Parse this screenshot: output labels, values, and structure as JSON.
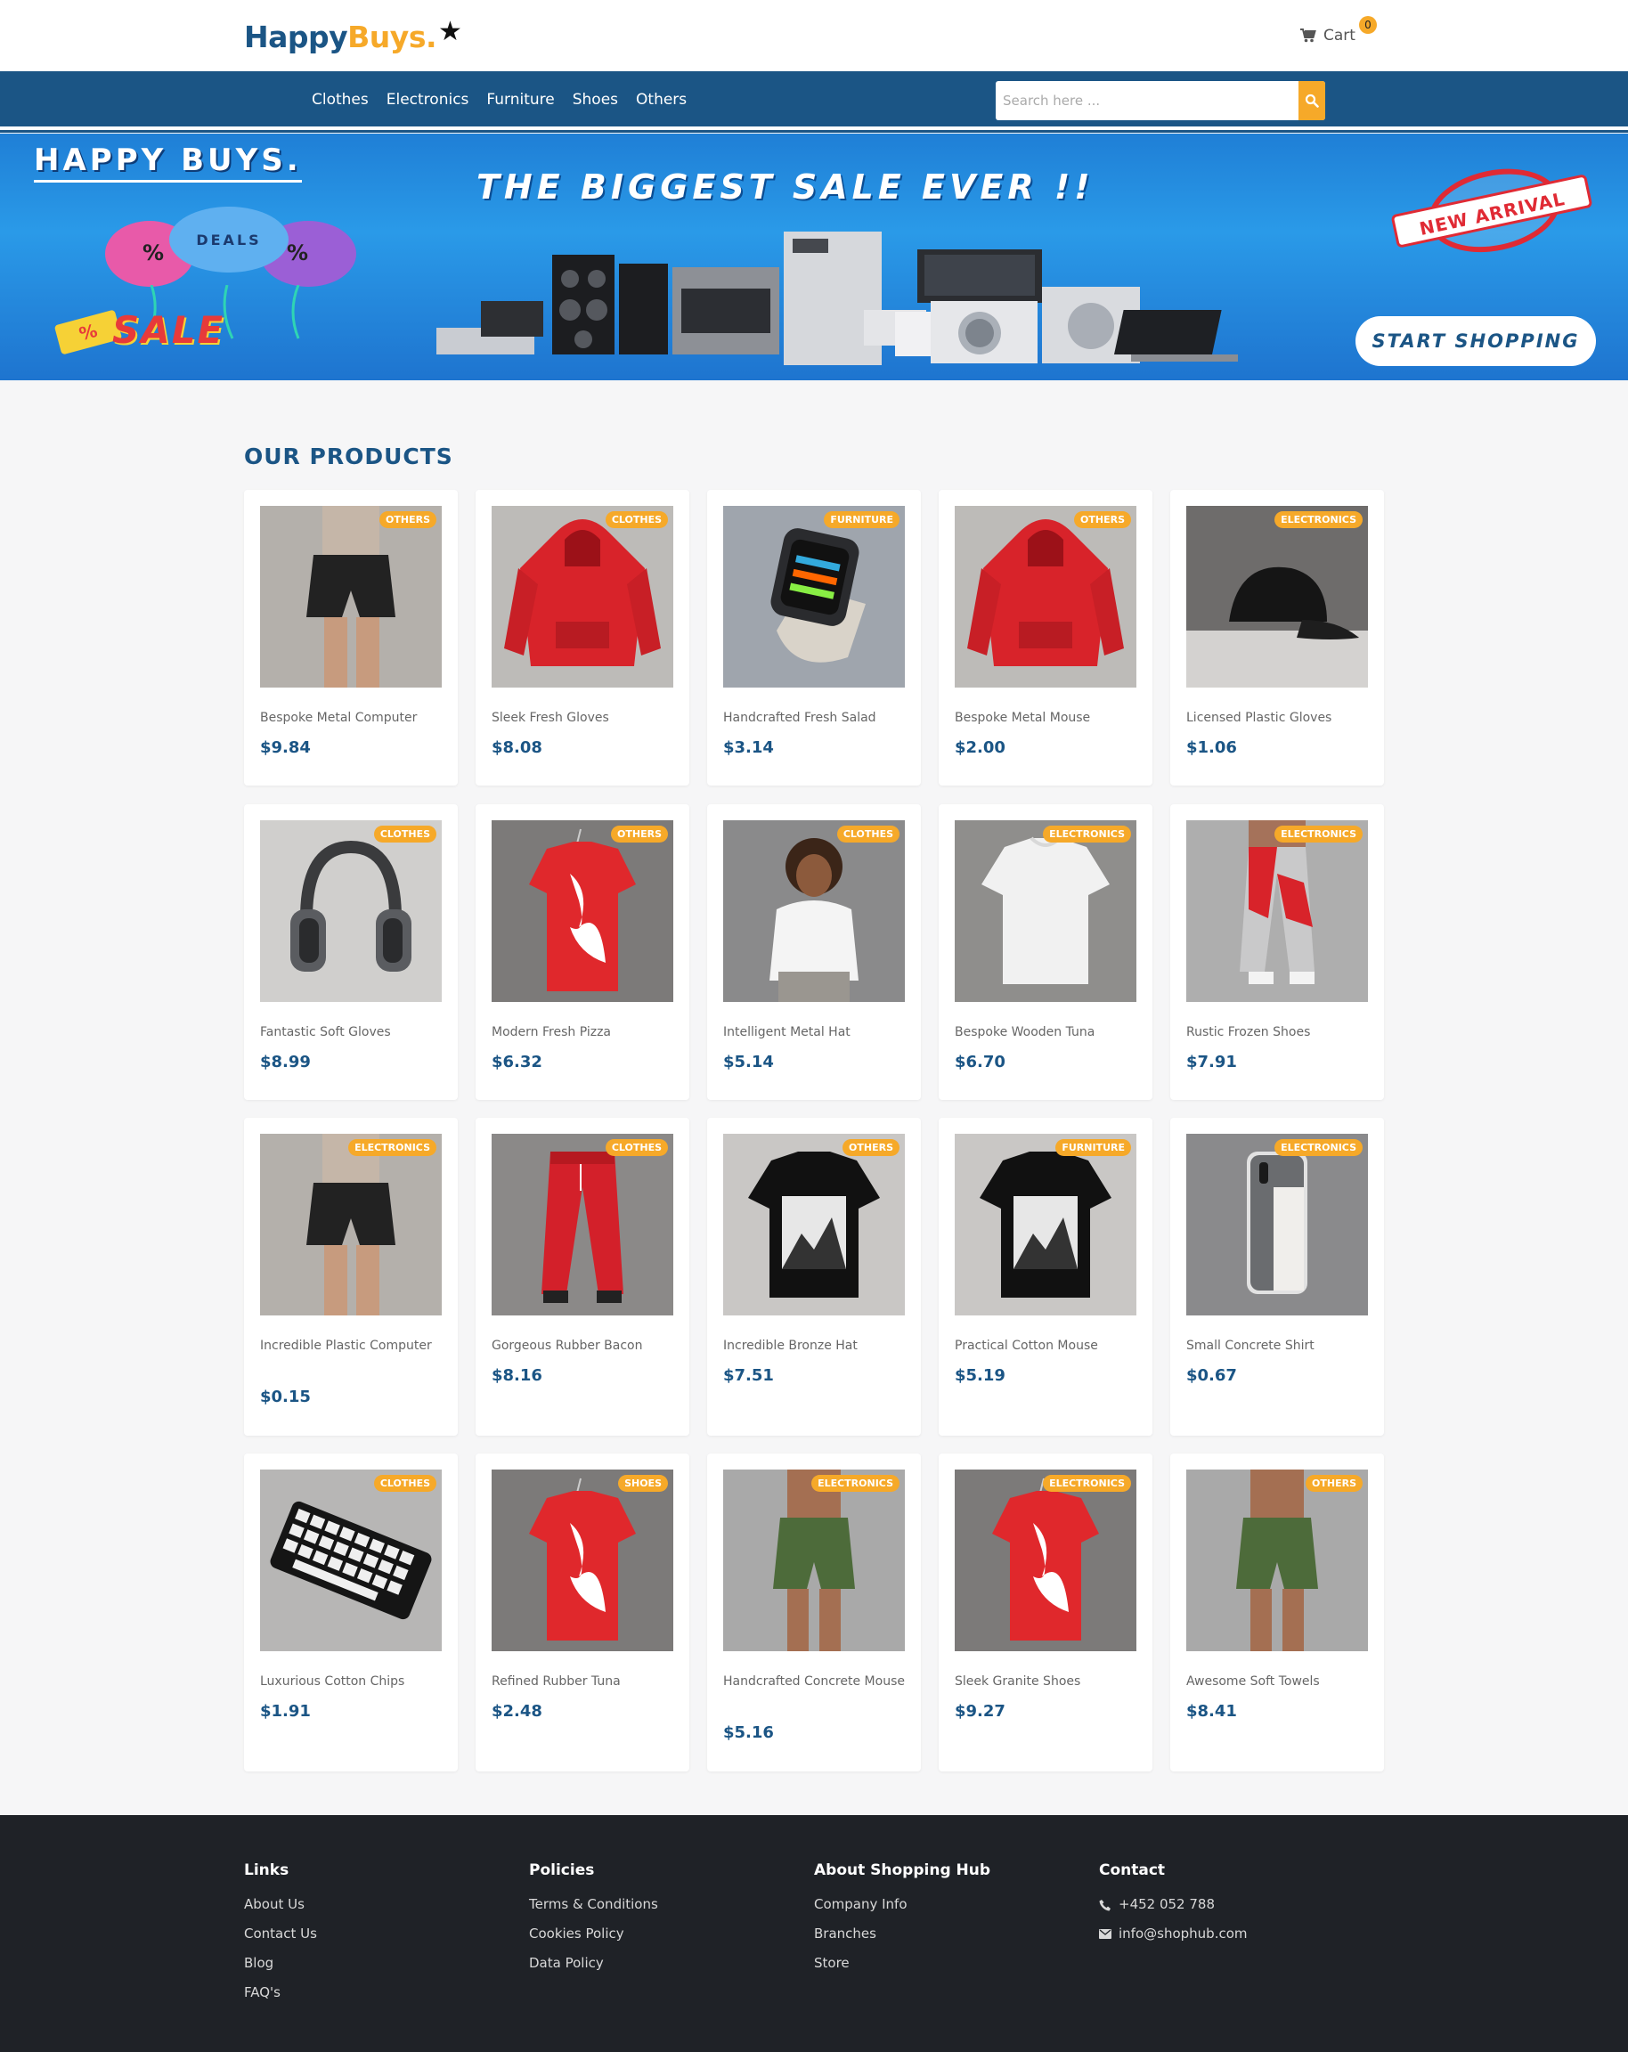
{
  "header": {
    "logo_part1": "Happy",
    "logo_part2": "Buys.",
    "logo_star": "★",
    "cart_label": "Cart",
    "cart_count": "0"
  },
  "nav": {
    "links": [
      "Clothes",
      "Electronics",
      "Furniture",
      "Shoes",
      "Others"
    ],
    "search_placeholder": "Search here ..."
  },
  "banner": {
    "brand": "HAPPY BUYS.",
    "headline": "THE BIGGEST SALE EVER !!",
    "deals": "DEALS",
    "sale": "SALE",
    "new_arrival": "NEW ARRIVAL",
    "cta": "START SHOPPING"
  },
  "products": {
    "title": "OUR PRODUCTS",
    "items": [
      {
        "name": "Bespoke Metal Computer",
        "price": "$9.84",
        "category": "OTHERS",
        "image": "shorts"
      },
      {
        "name": "Sleek Fresh Gloves",
        "price": "$8.08",
        "category": "CLOTHES",
        "image": "hoodie"
      },
      {
        "name": "Handcrafted Fresh Salad",
        "price": "$3.14",
        "category": "FURNITURE",
        "image": "watch"
      },
      {
        "name": "Bespoke Metal Mouse",
        "price": "$2.00",
        "category": "OTHERS",
        "image": "hoodie"
      },
      {
        "name": "Licensed Plastic Gloves",
        "price": "$1.06",
        "category": "ELECTRONICS",
        "image": "cap"
      },
      {
        "name": "Fantastic Soft Gloves",
        "price": "$8.99",
        "category": "CLOTHES",
        "image": "headphones"
      },
      {
        "name": "Modern Fresh Pizza",
        "price": "$6.32",
        "category": "OTHERS",
        "image": "red-tshirt"
      },
      {
        "name": "Intelligent Metal Hat",
        "price": "$5.14",
        "category": "CLOTHES",
        "image": "woman-tee"
      },
      {
        "name": "Bespoke Wooden Tuna",
        "price": "$6.70",
        "category": "ELECTRONICS",
        "image": "white-tshirt"
      },
      {
        "name": "Rustic Frozen Shoes",
        "price": "$7.91",
        "category": "ELECTRONICS",
        "image": "joggers-model"
      },
      {
        "name": "Incredible Plastic Computer",
        "price": "$0.15",
        "category": "ELECTRONICS",
        "image": "shorts"
      },
      {
        "name": "Gorgeous Rubber Bacon",
        "price": "$8.16",
        "category": "CLOTHES",
        "image": "red-pants"
      },
      {
        "name": "Incredible Bronze Hat",
        "price": "$7.51",
        "category": "OTHERS",
        "image": "black-tshirt"
      },
      {
        "name": "Practical Cotton Mouse",
        "price": "$5.19",
        "category": "FURNITURE",
        "image": "black-tshirt"
      },
      {
        "name": "Small Concrete Shirt",
        "price": "$0.67",
        "category": "ELECTRONICS",
        "image": "phone"
      },
      {
        "name": "Luxurious Cotton Chips",
        "price": "$1.91",
        "category": "CLOTHES",
        "image": "keyboard"
      },
      {
        "name": "Refined Rubber Tuna",
        "price": "$2.48",
        "category": "SHOES",
        "image": "red-tshirt"
      },
      {
        "name": "Handcrafted Concrete Mouse",
        "price": "$5.16",
        "category": "ELECTRONICS",
        "image": "green-shorts"
      },
      {
        "name": "Sleek Granite Shoes",
        "price": "$9.27",
        "category": "ELECTRONICS",
        "image": "red-tshirt"
      },
      {
        "name": "Awesome Soft Towels",
        "price": "$8.41",
        "category": "OTHERS",
        "image": "green-shorts"
      }
    ]
  },
  "footer": {
    "links": {
      "title": "Links",
      "items": [
        "About Us",
        "Contact Us",
        "Blog",
        "FAQ's"
      ]
    },
    "policies": {
      "title": "Policies",
      "items": [
        "Terms & Conditions",
        "Cookies Policy",
        "Data Policy"
      ]
    },
    "about": {
      "title": "About Shopping Hub",
      "items": [
        "Company Info",
        "Branches",
        "Store"
      ]
    },
    "contact": {
      "title": "Contact",
      "phone": "+452 052 788",
      "email": "info@shophub.com"
    }
  },
  "colors": {
    "primary": "#1b5585",
    "accent": "#f6a929",
    "footer": "#1f2227"
  }
}
